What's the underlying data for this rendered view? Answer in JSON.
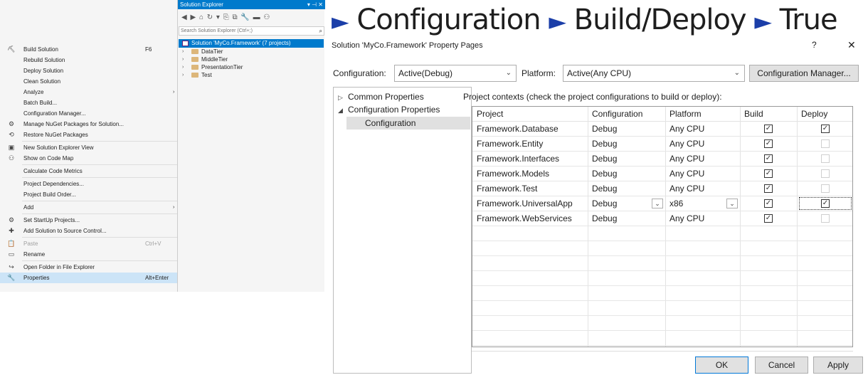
{
  "context_menu": {
    "items": [
      {
        "label": "Build Solution",
        "shortcut": "F6",
        "icon": "build-icon",
        "glyph": "⛏"
      },
      {
        "label": "Rebuild Solution"
      },
      {
        "label": "Deploy Solution"
      },
      {
        "label": "Clean Solution"
      },
      {
        "label": "Analyze",
        "submenu": true
      },
      {
        "label": "Batch Build..."
      },
      {
        "label": "Configuration Manager..."
      },
      {
        "label": "Manage NuGet Packages for Solution...",
        "icon": "nuget-icon",
        "glyph": "⚙"
      },
      {
        "label": "Restore NuGet Packages",
        "icon": "restore-icon",
        "glyph": "⟲"
      },
      {
        "sep": true
      },
      {
        "label": "New Solution Explorer View",
        "icon": "new-view-icon",
        "glyph": "▣"
      },
      {
        "label": "Show on Code Map",
        "icon": "code-map-icon",
        "glyph": "⚇"
      },
      {
        "sep": true
      },
      {
        "label": "Calculate Code Metrics"
      },
      {
        "sep": true
      },
      {
        "label": "Project Dependencies..."
      },
      {
        "label": "Project Build Order..."
      },
      {
        "sep": true
      },
      {
        "label": "Add",
        "submenu": true
      },
      {
        "sep": true
      },
      {
        "label": "Set StartUp Projects...",
        "icon": "gear-icon",
        "glyph": "⚙"
      },
      {
        "label": "Add Solution to Source Control...",
        "icon": "source-control-icon",
        "glyph": "✚"
      },
      {
        "sep": true
      },
      {
        "label": "Paste",
        "shortcut": "Ctrl+V",
        "icon": "paste-icon",
        "glyph": "📋",
        "disabled": true
      },
      {
        "label": "Rename",
        "icon": "rename-icon",
        "glyph": "▭"
      },
      {
        "sep": true
      },
      {
        "label": "Open Folder in File Explorer",
        "icon": "open-folder-icon",
        "glyph": "↪"
      },
      {
        "label": "Properties",
        "shortcut": "Alt+Enter",
        "icon": "wrench-icon",
        "glyph": "🔧",
        "highlight": true
      }
    ]
  },
  "solution_explorer": {
    "title": "Solution Explorer",
    "title_controls": "▾ ⊣ ✕",
    "toolbar_glyphs": "◀ ▶ ⌂  ↻ ▾ ⎘ ⧉  🔧 ▬ ⚇",
    "search_placeholder": "Search Solution Explorer (Ctrl+;)",
    "search_glyph": "⌕",
    "root": "Solution 'MyCo.Framework' (7 projects)",
    "folders": [
      "DataTier",
      "MiddleTier",
      "PresentationTier",
      "Test"
    ]
  },
  "headline": {
    "arrow": "►",
    "parts": [
      "Configuration",
      "Build/Deploy",
      "True"
    ]
  },
  "dialog": {
    "title": "Solution 'MyCo.Framework' Property Pages",
    "help": "?",
    "close": "✕",
    "configuration_label": "Configuration:",
    "configuration_value": "Active(Debug)",
    "platform_label": "Platform:",
    "platform_value": "Active(Any CPU)",
    "config_manager_button": "Configuration Manager...",
    "tree": [
      {
        "label": "Common Properties",
        "arrow": "▷"
      },
      {
        "label": "Configuration Properties",
        "arrow": "◢"
      },
      {
        "label": "Configuration",
        "selected": true
      }
    ],
    "contexts_caption": "Project contexts (check the project configurations to build or deploy):",
    "columns": [
      "Project",
      "Configuration",
      "Platform",
      "Build",
      "Deploy"
    ],
    "rows": [
      {
        "project": "Framework.Database",
        "configuration": "Debug",
        "platform": "Any CPU",
        "build": true,
        "deploy": true,
        "deploy_enabled": true
      },
      {
        "project": "Framework.Entity",
        "configuration": "Debug",
        "platform": "Any CPU",
        "build": true,
        "deploy": false,
        "deploy_enabled": false
      },
      {
        "project": "Framework.Interfaces",
        "configuration": "Debug",
        "platform": "Any CPU",
        "build": true,
        "deploy": false,
        "deploy_enabled": false
      },
      {
        "project": "Framework.Models",
        "configuration": "Debug",
        "platform": "Any CPU",
        "build": true,
        "deploy": false,
        "deploy_enabled": false
      },
      {
        "project": "Framework.Test",
        "configuration": "Debug",
        "platform": "Any CPU",
        "build": true,
        "deploy": false,
        "deploy_enabled": false
      },
      {
        "project": "Framework.UniversalApp",
        "configuration": "Debug",
        "platform": "x86",
        "build": true,
        "deploy": true,
        "deploy_enabled": true,
        "dropdowns": true
      },
      {
        "project": "Framework.WebServices",
        "configuration": "Debug",
        "platform": "Any CPU",
        "build": true,
        "deploy": false,
        "deploy_enabled": false
      }
    ],
    "ok_button": "OK",
    "cancel_button": "Cancel",
    "apply_button": "Apply",
    "checkmark": "✓",
    "chevron": "⌄"
  }
}
